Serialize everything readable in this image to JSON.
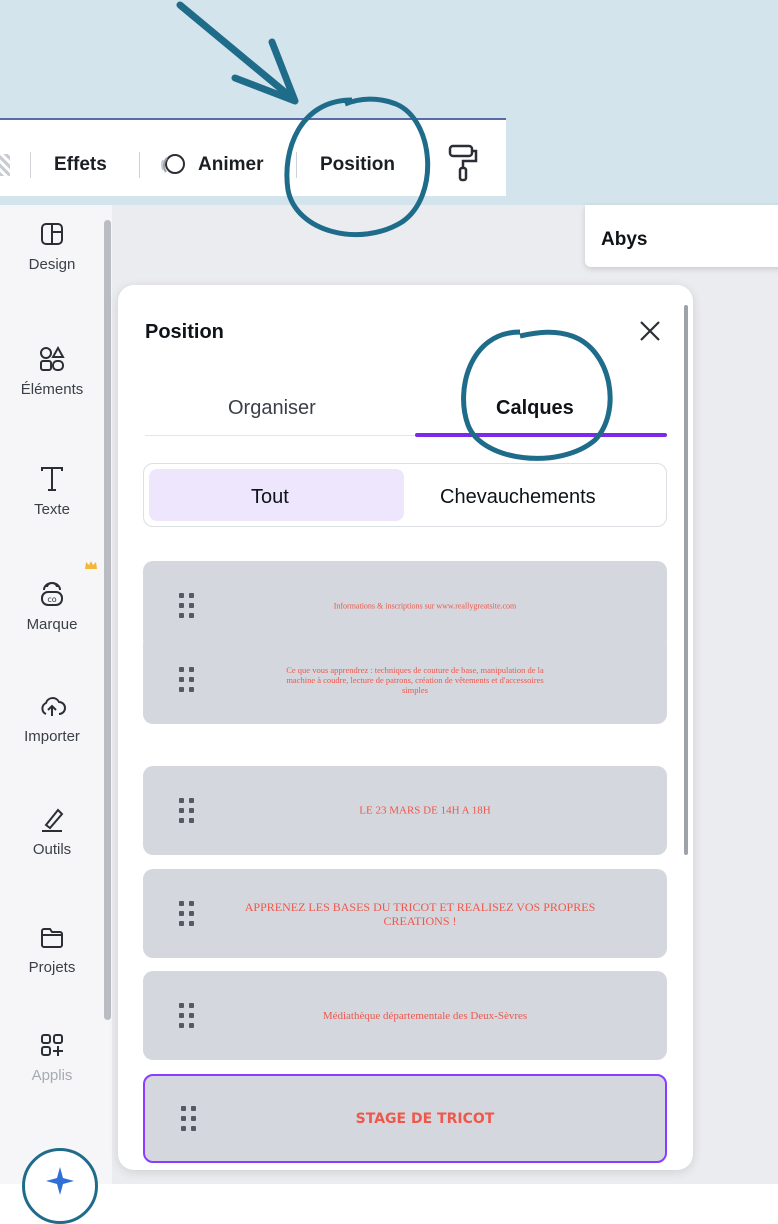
{
  "toolbar": {
    "effects": "Effets",
    "animate": "Animer",
    "position": "Position"
  },
  "sidebar": {
    "items": [
      {
        "label": "Design",
        "icon": "layout-icon"
      },
      {
        "label": "Éléments",
        "icon": "shapes-icon"
      },
      {
        "label": "Texte",
        "icon": "text-icon"
      },
      {
        "label": "Marque",
        "icon": "brand-icon"
      },
      {
        "label": "Importer",
        "icon": "cloud-upload-icon"
      },
      {
        "label": "Outils",
        "icon": "pen-icon"
      },
      {
        "label": "Projets",
        "icon": "folder-icon"
      },
      {
        "label": "Applis",
        "icon": "apps-icon"
      }
    ]
  },
  "font_box": {
    "value": "Abys"
  },
  "panel": {
    "title": "Position",
    "tabs": {
      "organise": "Organiser",
      "layers": "Calques"
    },
    "filter": {
      "all": "Tout",
      "overlaps": "Chevauchements"
    },
    "layers": [
      {
        "text": "Informations & inscriptions sur www.reallygreatsite.com"
      },
      {
        "text": "Ce que vous apprendrez : techniques de couture de base, manipulation de la machine à coudre, lecture de patrons, création de vêtements et d'accessoires simples"
      },
      {
        "text": "LE 23 MARS DE 14H A 18H"
      },
      {
        "text": "APPRENEZ LES BASES DU TRICOT ET REALISEZ VOS PROPRES CREATIONS !"
      },
      {
        "text": "Médiathèque départementale des Deux-Sèvres"
      },
      {
        "text": "STAGE DE TRICOT"
      }
    ]
  },
  "colors": {
    "accent": "#7d2ae8",
    "annotation": "#1f6c8a",
    "layer_text": "#f0574b"
  }
}
